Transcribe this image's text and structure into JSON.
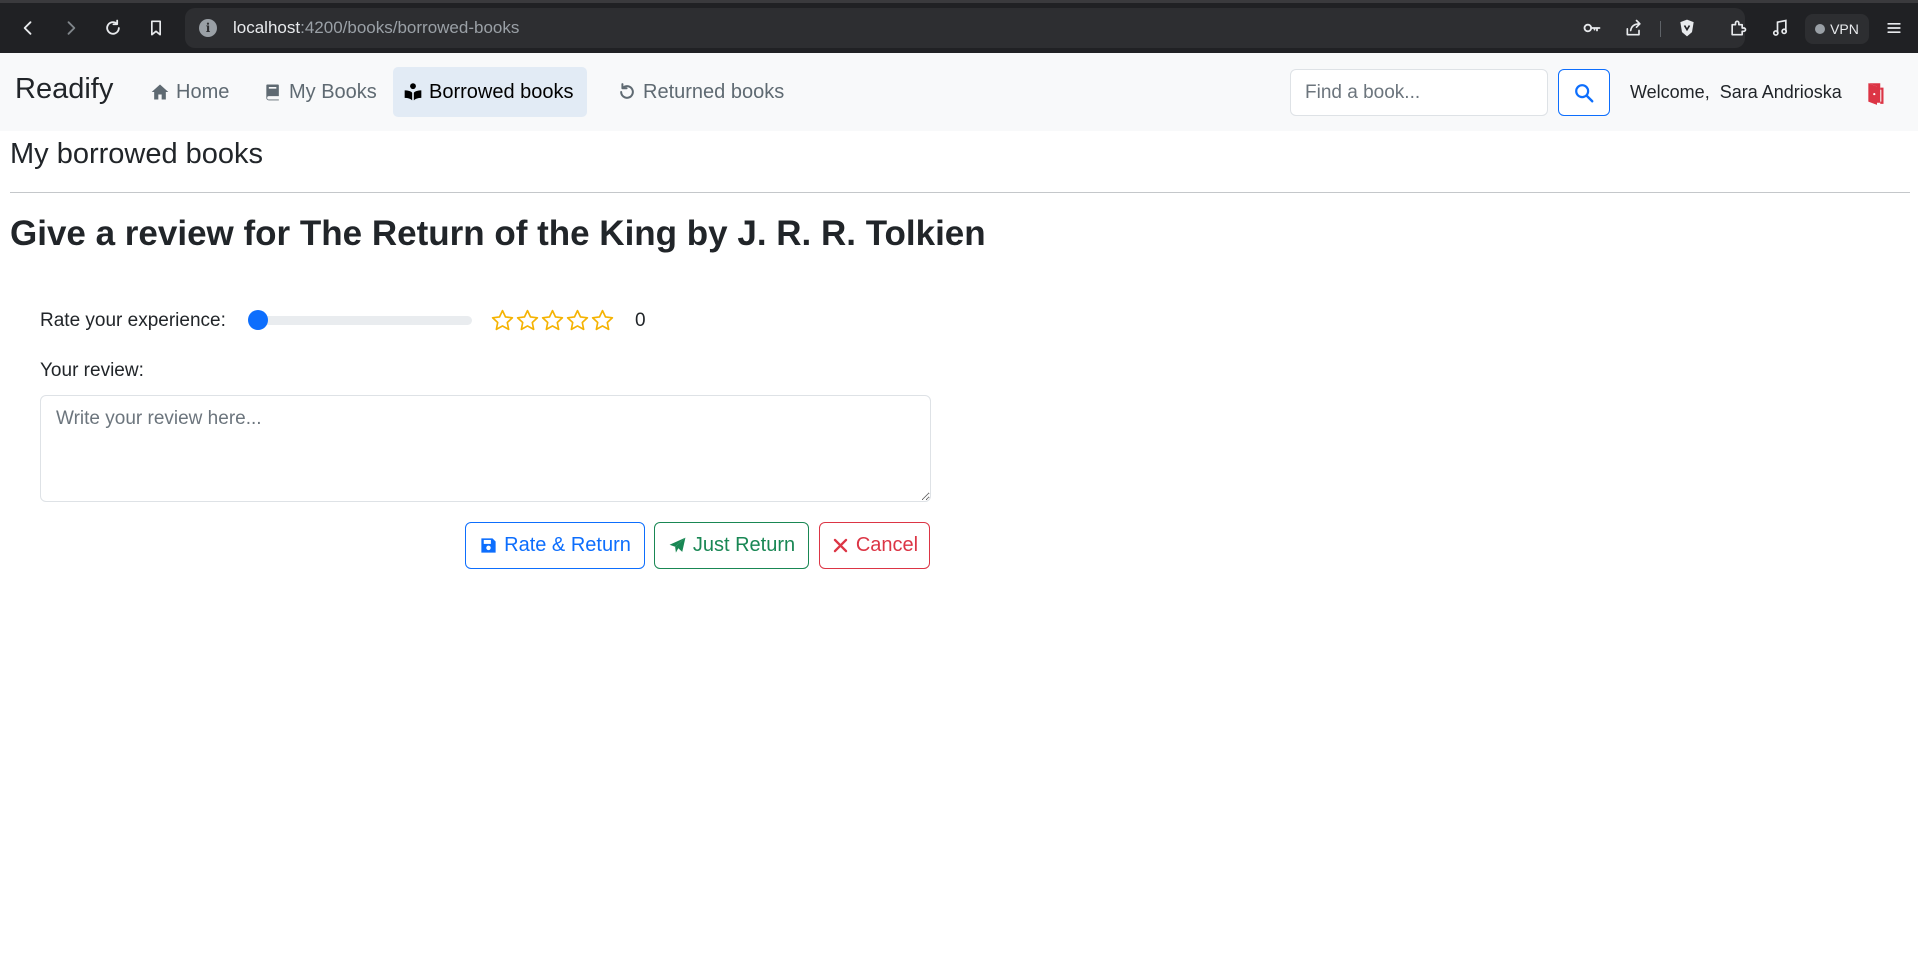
{
  "browser": {
    "url_host": "localhost",
    "url_path": ":4200/books/borrowed-books",
    "vpn_label": "VPN"
  },
  "navbar": {
    "brand": "Readify",
    "links": [
      {
        "label": "Home",
        "icon": "home-icon"
      },
      {
        "label": "My Books",
        "icon": "book-icon"
      },
      {
        "label": "Borrowed books",
        "icon": "reader-icon",
        "active": true
      },
      {
        "label": "Returned books",
        "icon": "undo-icon"
      }
    ],
    "search_placeholder": "Find a book...",
    "welcome_prefix": "Welcome,",
    "user_name": "Sara Andrioska"
  },
  "page": {
    "title": "My borrowed books",
    "review_prefix": "Give a review for",
    "book_title": "The Return of the King by J. R. R. Tolkien",
    "rate_label": "Rate your experience:",
    "rating": 0,
    "rating_max": 5,
    "review_label": "Your review:",
    "review_placeholder": "Write your review here...",
    "buttons": {
      "rate_return": "Rate & Return",
      "just_return": "Just Return",
      "cancel": "Cancel"
    }
  },
  "colors": {
    "primary": "#0d6efd",
    "success": "#198754",
    "danger": "#dc3545",
    "star": "#f5b301",
    "navbar_bg": "#f8f9fa"
  }
}
